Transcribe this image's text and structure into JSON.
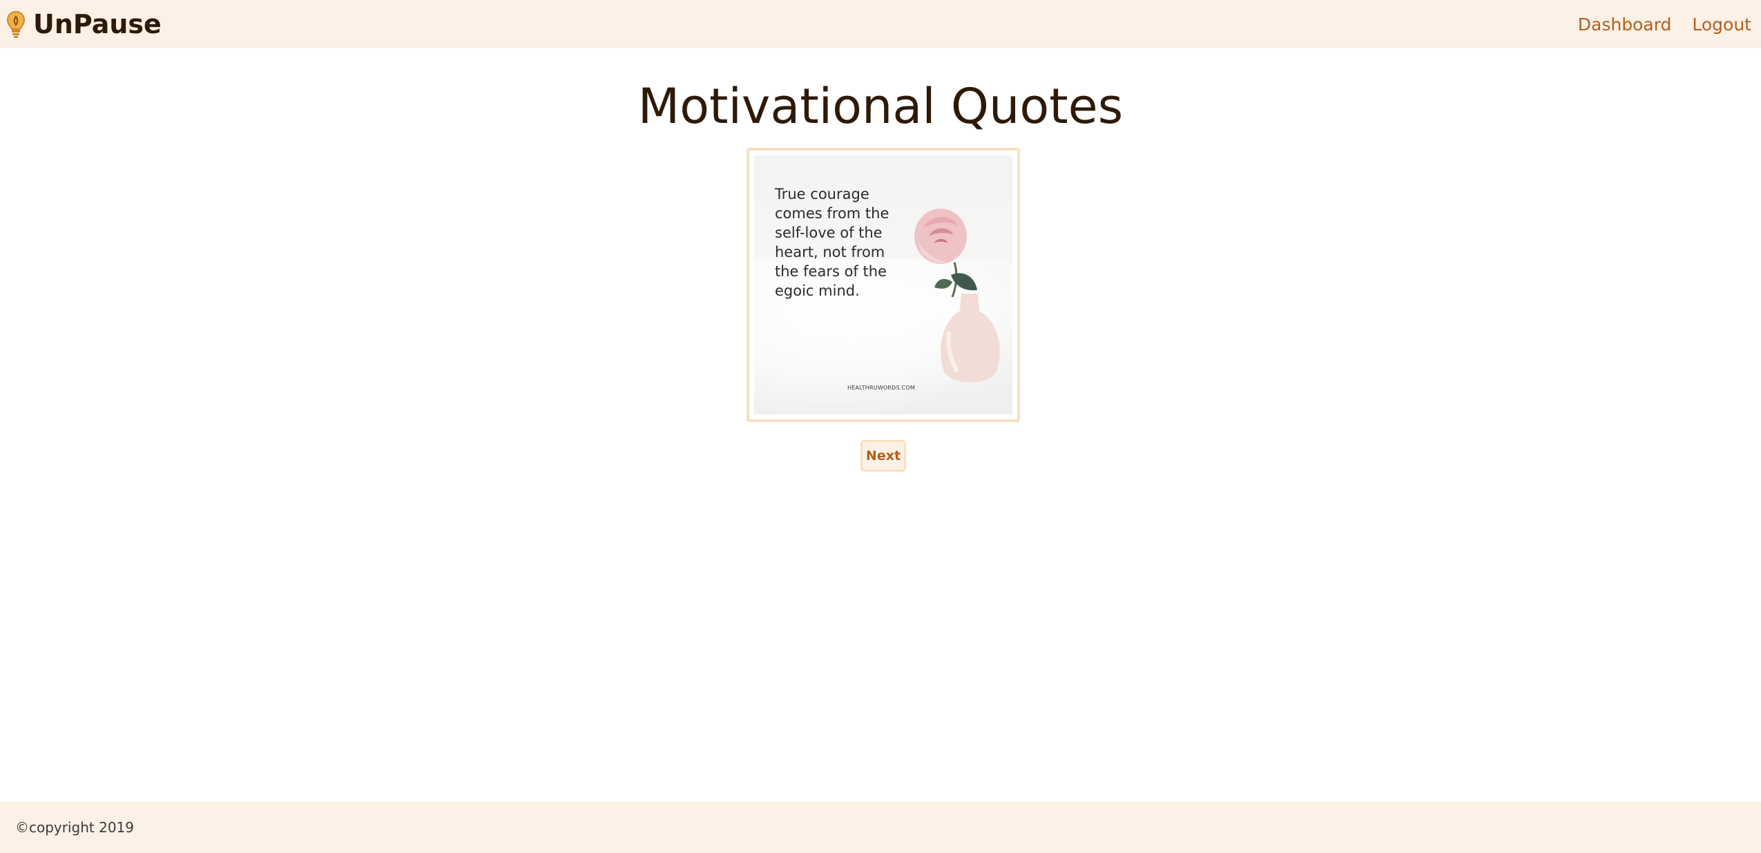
{
  "navbar": {
    "brand": "UnPause",
    "brand_icon": "lightbulb-icon",
    "links": [
      {
        "label": "Dashboard"
      },
      {
        "label": "Logout"
      }
    ]
  },
  "main": {
    "title": "Motivational Quotes",
    "quote_card": {
      "quote": "True courage\ncomes from the\nself-love of the\nheart, not from\nthe fears of the\negoic mind.",
      "watermark": "HEALTHRUWORDS.COM"
    },
    "next_label": "Next"
  },
  "footer": {
    "copyright": "©copyright 2019"
  },
  "colors": {
    "header_bg": "#fcf1e6",
    "accent": "#b25f1c",
    "title": "#2e1a09",
    "border": "#f8dfbf"
  }
}
